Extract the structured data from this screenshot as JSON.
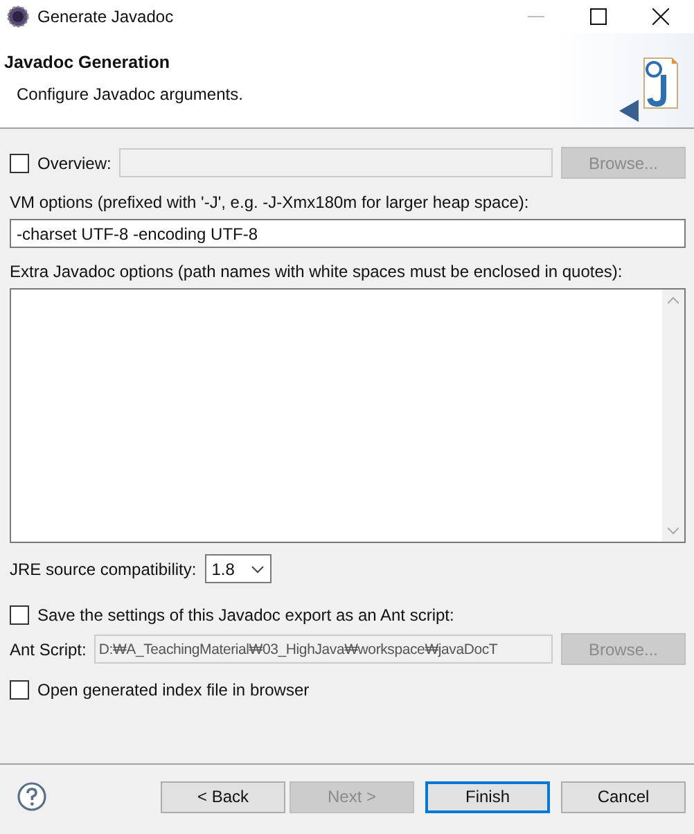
{
  "window": {
    "title": "Generate Javadoc"
  },
  "header": {
    "title": "Javadoc Generation",
    "description": "Configure Javadoc arguments."
  },
  "overview": {
    "label": "Overview:",
    "checked": false,
    "browse": {
      "label": "Browse...",
      "disabled": true
    }
  },
  "vm_options": {
    "label": "VM options (prefixed with '-J', e.g. -J-Xmx180m for larger heap space):",
    "value": "-charset UTF-8 -encoding UTF-8"
  },
  "extra_options": {
    "label": "Extra Javadoc options (path names with white spaces must be enclosed in quotes):"
  },
  "jre": {
    "label": "JRE source compatibility:",
    "value": "1.8"
  },
  "save_ant": {
    "label": "Save the settings of this Javadoc export as an Ant script:",
    "checked": false
  },
  "ant_script": {
    "label": "Ant Script:",
    "value": "D:₩A_TeachingMaterial₩03_HighJava₩workspace₩javaDocT",
    "disabled": true,
    "browse": {
      "label": "Browse...",
      "disabled": true
    }
  },
  "open_index": {
    "label": "Open generated index file in browser",
    "checked": false
  },
  "buttons": [
    {
      "kind": "nav",
      "label": "< Back",
      "disabled": false,
      "default": false
    },
    {
      "kind": "nav",
      "label": "Next >",
      "disabled": true,
      "default": false
    },
    {
      "kind": "action",
      "label": "Finish",
      "disabled": false,
      "default": true
    },
    {
      "kind": "action",
      "label": "Cancel",
      "disabled": false,
      "default": false
    }
  ]
}
